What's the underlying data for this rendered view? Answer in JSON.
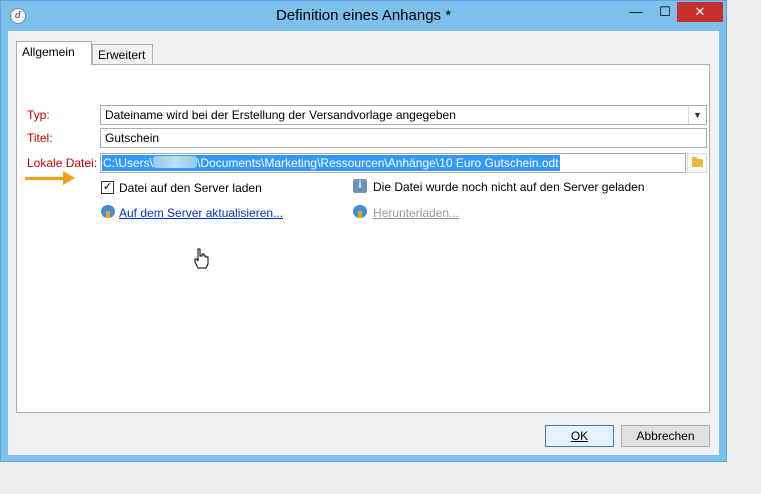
{
  "window": {
    "title": "Definition eines Anhangs *",
    "controls": {
      "minimize": "—",
      "maximize": "☐",
      "close": "✕"
    }
  },
  "tabs": [
    {
      "label": "Allgemein",
      "active": true
    },
    {
      "label": "Erweitert",
      "active": false
    }
  ],
  "form": {
    "typ_label": "Typ:",
    "typ_value": "Dateiname wird bei der Erstellung der Versandvorlage angegeben",
    "titel_label": "Titel:",
    "titel_value": "Gutschein",
    "datei_label": "Lokale Datei:",
    "datei_prefix": "C:\\Users\\",
    "datei_suffix": "\\Documents\\Marketing\\Ressourcen\\Anhänge\\10 Euro Gutschein.odt",
    "upload_checkbox_label": "Datei auf den Server laden",
    "upload_checked": true,
    "info_text": "Die Datei wurde noch nicht auf den Server geladen",
    "update_link": "Auf dem Server aktualisieren...",
    "download_link": "Herunterladen..."
  },
  "buttons": {
    "ok": "OK",
    "cancel": "Abbrechen"
  },
  "colors": {
    "required_label": "#cc0000",
    "titlebar": "#7dc0ec",
    "close_button": "#c7312b",
    "selection": "#3399ff",
    "callout_arrow": "#f6a01a",
    "link": "#0033cc"
  },
  "icons": [
    "app-icon",
    "combo-chevron-icon",
    "folder-icon",
    "info-icon",
    "cloud-upload-icon",
    "cloud-download-icon",
    "hand-cursor-icon",
    "callout-arrow-icon"
  ]
}
